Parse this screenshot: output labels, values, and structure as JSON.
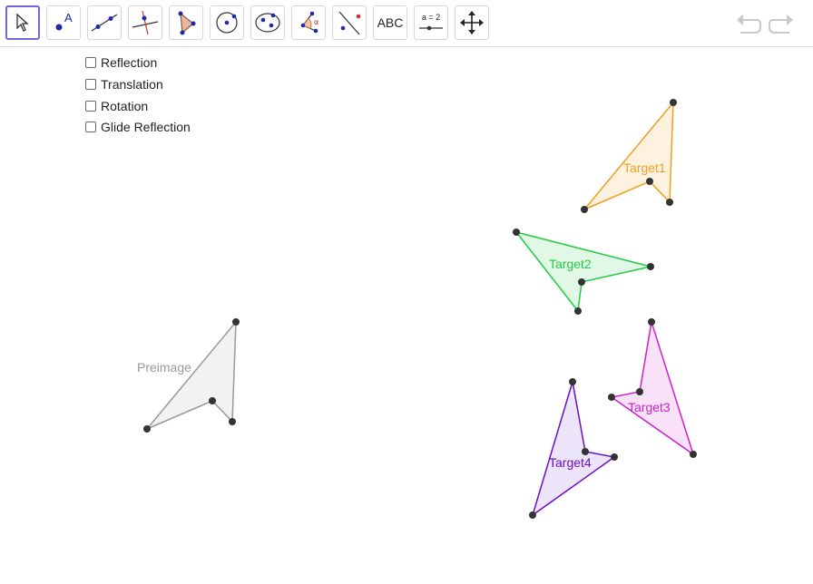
{
  "toolbar": {
    "tools": [
      {
        "name": "move-tool",
        "icon": "arrow-pointer-icon",
        "selected": true
      },
      {
        "name": "point-tool",
        "icon": "point-icon",
        "glyph": "A"
      },
      {
        "name": "line-tool",
        "icon": "line-through-points-icon"
      },
      {
        "name": "perpendicular-line-tool",
        "icon": "perpendicular-line-icon"
      },
      {
        "name": "polygon-tool",
        "icon": "polygon-icon"
      },
      {
        "name": "circle-tool",
        "icon": "circle-center-point-icon"
      },
      {
        "name": "ellipse-tool",
        "icon": "ellipse-icon"
      },
      {
        "name": "angle-tool",
        "icon": "angle-icon",
        "glyph": "α"
      },
      {
        "name": "reflect-tool",
        "icon": "reflect-about-line-icon"
      },
      {
        "name": "text-tool",
        "icon": "text-icon",
        "label": "ABC"
      },
      {
        "name": "slider-tool",
        "icon": "slider-icon",
        "label": "a = 2"
      },
      {
        "name": "move-graphics-view-tool",
        "icon": "move-arrows-icon"
      }
    ],
    "undo_icon": "undo-icon",
    "redo_icon": "redo-icon"
  },
  "checkboxes": [
    {
      "label": "Reflection",
      "checked": false
    },
    {
      "label": "Translation",
      "checked": false
    },
    {
      "label": "Rotation",
      "checked": false
    },
    {
      "label": "Glide Reflection",
      "checked": false
    }
  ],
  "shapes": [
    {
      "label": "Preimage",
      "color": "#999999",
      "fill": "#f2f2f2"
    },
    {
      "label": "Target1",
      "color": "#f0a020",
      "fill": "#fdf1df"
    },
    {
      "label": "Target2",
      "color": "#22cc44",
      "fill": "#e2f8e6"
    },
    {
      "label": "Target3",
      "color": "#cc22cc",
      "fill": "#f9e1f7"
    },
    {
      "label": "Target4",
      "color": "#6a0fc8",
      "fill": "#ece4f8"
    }
  ],
  "colors": {
    "selected_border": "#6b6bd6",
    "point": "#333333",
    "disabled_icon": "#c8c8c8"
  }
}
